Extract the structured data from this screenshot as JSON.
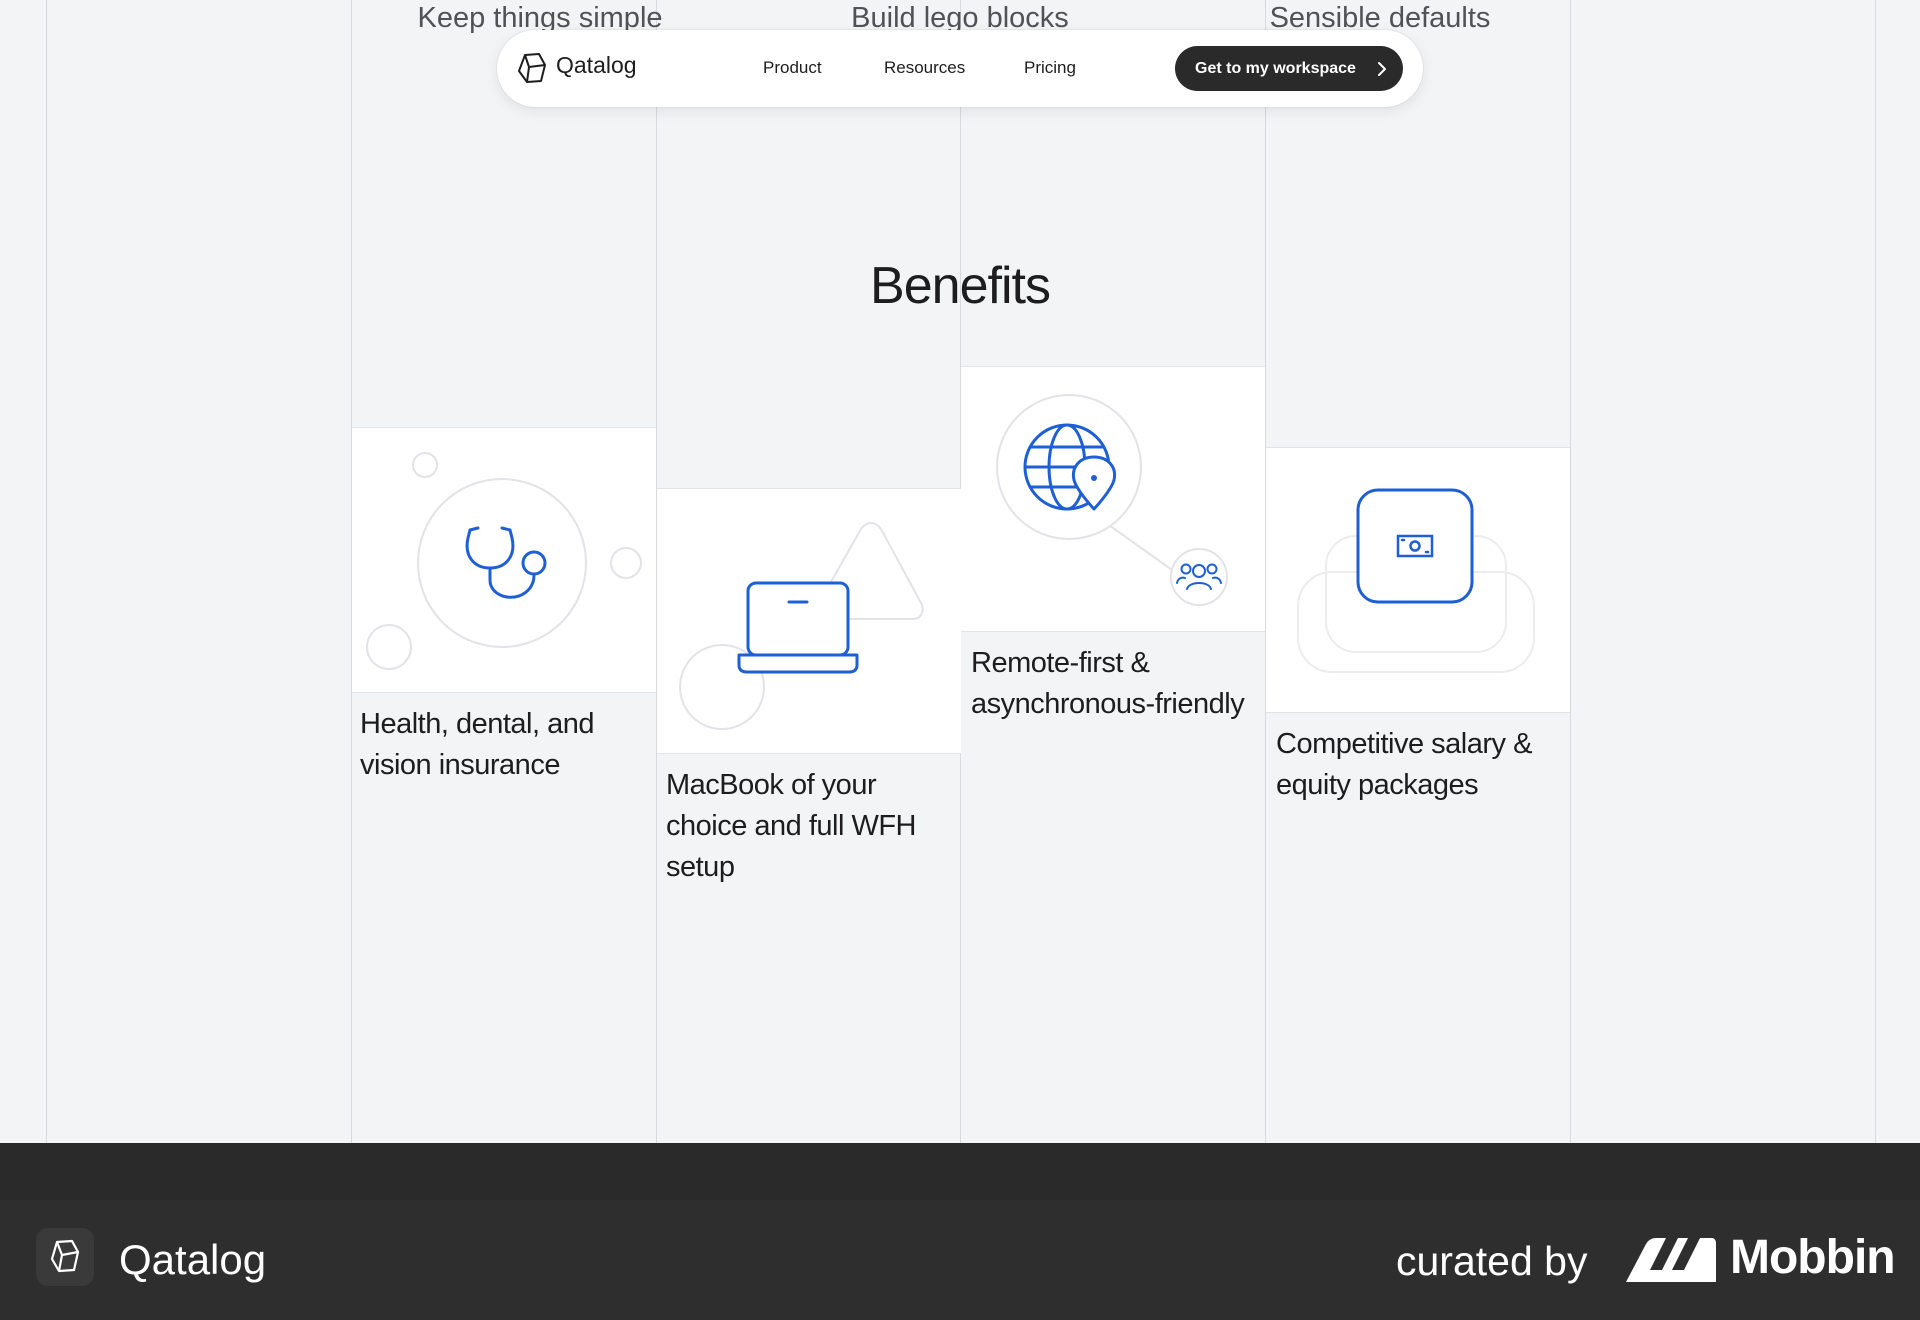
{
  "top_words": [
    "Keep things simple",
    "Build lego blocks",
    "Sensible defaults"
  ],
  "nav": {
    "brand": "Qatalog",
    "links": [
      "Product",
      "Resources",
      "Pricing"
    ],
    "cta": "Get to my workspace"
  },
  "section_title": "Benefits",
  "benefits": [
    {
      "label": "Health, dental, and vision insurance",
      "icon": "stethoscope-icon"
    },
    {
      "label": "MacBook of your choice and full WFH setup",
      "icon": "laptop-icon"
    },
    {
      "label": "Remote-first & asynchronous-friendly",
      "icon": "globe-location-icon"
    },
    {
      "label": "Competitive salary & equity packages",
      "icon": "money-icon"
    }
  ],
  "footer": {
    "brand": "Qatalog",
    "curated_by": "curated by",
    "curator": "Mobbin"
  },
  "colors": {
    "accent_blue": "#1f5fd6",
    "background": "#f3f4f6",
    "footer": "#2e2e2e",
    "cta": "#2a2a2a"
  }
}
